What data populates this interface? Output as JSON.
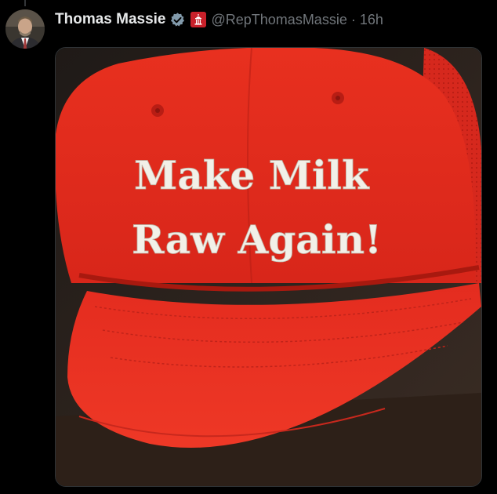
{
  "tweet": {
    "author_name": "Thomas Massie",
    "handle": "@RepThomasMassie",
    "separator": "·",
    "timestamp": "16h",
    "verified_icon": "verified-badge-icon",
    "affiliation_icon": "us-house-affiliation-icon",
    "media": {
      "hat_text_line1": "Make Milk",
      "hat_text_line2": "Raw Again!",
      "hat_color": "#e02a1f",
      "text_color": "#f2f0e8"
    }
  },
  "colors": {
    "background": "#000000",
    "name": "#e7e9ea",
    "secondary": "#71767b",
    "verified": "#829aab"
  }
}
